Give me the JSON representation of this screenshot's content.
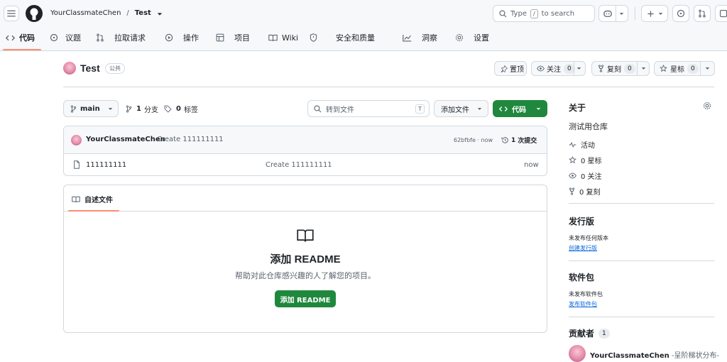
{
  "header": {
    "owner": "YourClassmateChen",
    "separator": "/",
    "repo": "Test",
    "search_prefix": "Type",
    "search_key": "/",
    "search_suffix": "to search"
  },
  "nav": [
    {
      "label": "代码",
      "icon": "code-icon"
    },
    {
      "label": "议题",
      "icon": "issue-icon"
    },
    {
      "label": "拉取请求",
      "icon": "pull-request-icon"
    },
    {
      "label": "操作",
      "icon": "play-icon"
    },
    {
      "label": "项目",
      "icon": "table-icon"
    },
    {
      "label": "Wiki",
      "icon": "book-icon"
    },
    {
      "label": "安全和质量",
      "icon": "shield-icon"
    },
    {
      "label": "洞察",
      "icon": "graph-icon"
    },
    {
      "label": "设置",
      "icon": "gear-icon"
    }
  ],
  "repo": {
    "name": "Test",
    "visibility": "公共",
    "pin_label": "置顶",
    "watch_label": "关注",
    "watch_count": "0",
    "fork_label": "复刻",
    "fork_count": "0",
    "star_label": "星标",
    "star_count": "0"
  },
  "toolbar": {
    "branch": "main",
    "branches_count": "1",
    "branches_label": "分支",
    "tags_count": "0",
    "tags_label": "标签",
    "goto_placeholder": "转到文件",
    "goto_key": "T",
    "add_file_label": "添加文件",
    "code_label": "代码"
  },
  "commit": {
    "author": "YourClassmateChen",
    "message": "Create 111111111",
    "hash_time": "62bfbfe · now",
    "commits_count": "1",
    "commits_label": "次提交"
  },
  "files": [
    {
      "name": "111111111",
      "message": "Create 111111111",
      "time": "now"
    }
  ],
  "readme": {
    "tab_label": "自述文件",
    "title": "添加 README",
    "description": "帮助对此仓库感兴趣的人了解您的项目。",
    "button_label": "添加 README"
  },
  "sidebar": {
    "about_title": "关于",
    "description": "测试用仓库",
    "activity_label": "活动",
    "stars_text": "0 星标",
    "watchers_text": "0 关注",
    "forks_text": "0 复刻",
    "releases_title": "发行版",
    "releases_none": "未发布任何版本",
    "releases_link": "创建发行版",
    "packages_title": "软件包",
    "packages_none": "未发布软件包",
    "packages_link": "发布软件包",
    "contributors_title": "贡献者",
    "contributors_count": "1",
    "contributor_name": "YourClassmateChen",
    "contributor_note": "-呈阶梯状分布-"
  },
  "colors": {
    "accent_green": "#1f883d",
    "tab_underline": "#fd8c73",
    "link_blue": "#0969da"
  }
}
